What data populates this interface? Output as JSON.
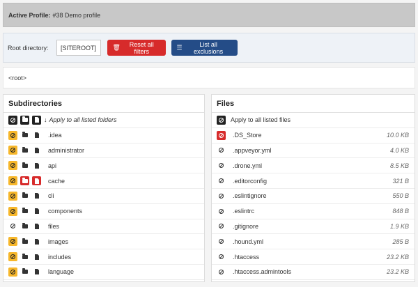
{
  "profile": {
    "label": "Active Profile:",
    "value": "#38 Demo profile"
  },
  "toolbar": {
    "root_label": "Root directory:",
    "root_value": "[SITEROOT]",
    "reset_label": "Reset all filters",
    "list_label": "List all exclusions"
  },
  "path": "<root>",
  "subdirectories": {
    "title": "Subdirectories",
    "apply_label": "Apply to all listed folders",
    "items": [
      {
        "name": ".idea",
        "state": "yellow"
      },
      {
        "name": "administrator",
        "state": "yellow"
      },
      {
        "name": "api",
        "state": "yellow"
      },
      {
        "name": "cache",
        "state": "red"
      },
      {
        "name": "cli",
        "state": "yellow"
      },
      {
        "name": "components",
        "state": "yellow"
      },
      {
        "name": "files",
        "state": "plain"
      },
      {
        "name": "images",
        "state": "yellow"
      },
      {
        "name": "includes",
        "state": "yellow"
      },
      {
        "name": "language",
        "state": "yellow"
      }
    ]
  },
  "files": {
    "title": "Files",
    "apply_label": "Apply to all listed files",
    "items": [
      {
        "name": ".DS_Store",
        "size": "10.0 KB",
        "state": "red"
      },
      {
        "name": ".appveyor.yml",
        "size": "4.0 KB",
        "state": "plain"
      },
      {
        "name": ".drone.yml",
        "size": "8.5 KB",
        "state": "plain"
      },
      {
        "name": ".editorconfig",
        "size": "321 B",
        "state": "plain"
      },
      {
        "name": ".eslintignore",
        "size": "550 B",
        "state": "plain"
      },
      {
        "name": ".eslintrc",
        "size": "848 B",
        "state": "plain"
      },
      {
        "name": ".gitignore",
        "size": "1.9 KB",
        "state": "plain"
      },
      {
        "name": ".hound.yml",
        "size": "285 B",
        "state": "plain"
      },
      {
        "name": ".htaccess",
        "size": "23.2 KB",
        "state": "plain"
      },
      {
        "name": ".htaccess.admintools",
        "size": "23.2 KB",
        "state": "plain"
      }
    ]
  },
  "colors": {
    "yellow": "#f7b72b",
    "red": "#d72b2b",
    "blue": "#244c87",
    "black": "#222222"
  }
}
